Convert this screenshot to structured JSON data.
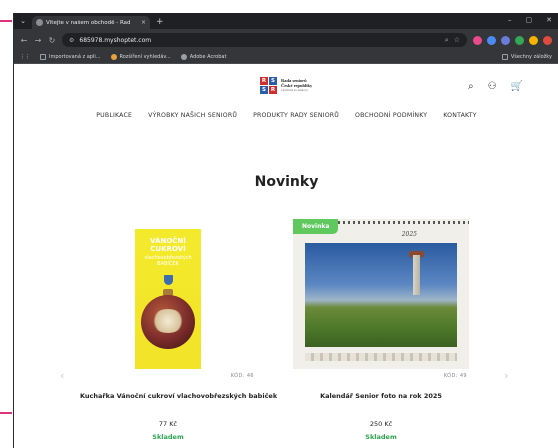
{
  "browser": {
    "tab_title": "Vítejte v našem obchodě - Rad",
    "tab_close": "×",
    "new_tab": "+",
    "url": "685978.myshoptet.com",
    "bookmarks": [
      "Importovaná z apli...",
      "Rozšíření vyhledáv...",
      "Adobe Acrobat"
    ],
    "bookmarks_right": "Všechny záložky"
  },
  "site": {
    "logo": {
      "letters": [
        "R",
        "S",
        "S",
        "R"
      ],
      "line1": "Rada seniorů",
      "line2": "České republiky",
      "line3": "výstavní za seniory"
    },
    "menu": [
      "PUBLIKACE",
      "VÝROBKY NAŠICH SENIORŮ",
      "PRODUKTY RADY SENIORŮ",
      "OBCHODNÍ PODMÍNKY",
      "KONTAKTY"
    ],
    "section_title": "Novinky"
  },
  "products": [
    {
      "name": "Kuchařka Vánoční cukroví vlachovobřezských babiček",
      "code": "KÓD: 46",
      "price": "77 Kč",
      "stock": "Skladem",
      "cover_title": "VÁNOČNÍ CUKROVÍ",
      "cover_subtitle": "vlachovobřezských BABIČEK"
    },
    {
      "name": "Kalendář Senior foto na rok 2025",
      "code": "KÓD: 49",
      "price": "250 Kč",
      "stock": "Skladem",
      "badge": "Novinka",
      "cover_year": "2025"
    }
  ],
  "colors": {
    "accent_green": "#5fc95f",
    "stock_green": "#2ea44f",
    "button_blue": "#5b8dd6"
  },
  "icons": {
    "search": "⌕",
    "account": "⚇",
    "cart": "🛒",
    "prev": "‹",
    "next": "›"
  }
}
